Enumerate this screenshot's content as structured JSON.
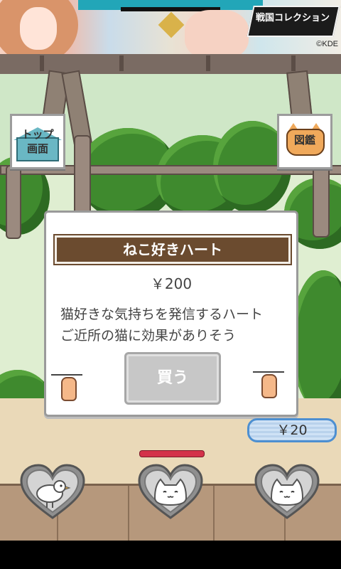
{
  "ad_banner": {
    "logo_text": "戦国コレクション",
    "copyright": "©KDE"
  },
  "nav": {
    "top_screen_label_line1": "トップ",
    "top_screen_label_line2": "画面",
    "zukan_label": "図鑑"
  },
  "item_dialog": {
    "title": "ねこ好きハート",
    "price": "￥200",
    "description_line1": "猫好きな気持ちを発信するハート",
    "description_line2": "ご近所の猫に効果がありそう",
    "buy_label": "買う"
  },
  "wallet": {
    "money": "￥20"
  },
  "colors": {
    "title_bar": "#6b4b2f",
    "buy_disabled": "#c7c7c7",
    "money_border": "#4d8fd1",
    "page_indicator": "#d3324a",
    "bush": "#3f8a2e"
  },
  "bottom_tabs": [
    {
      "icon": "bird-heart-icon"
    },
    {
      "icon": "cat-heart-icon"
    },
    {
      "icon": "cat-heart-icon"
    }
  ]
}
